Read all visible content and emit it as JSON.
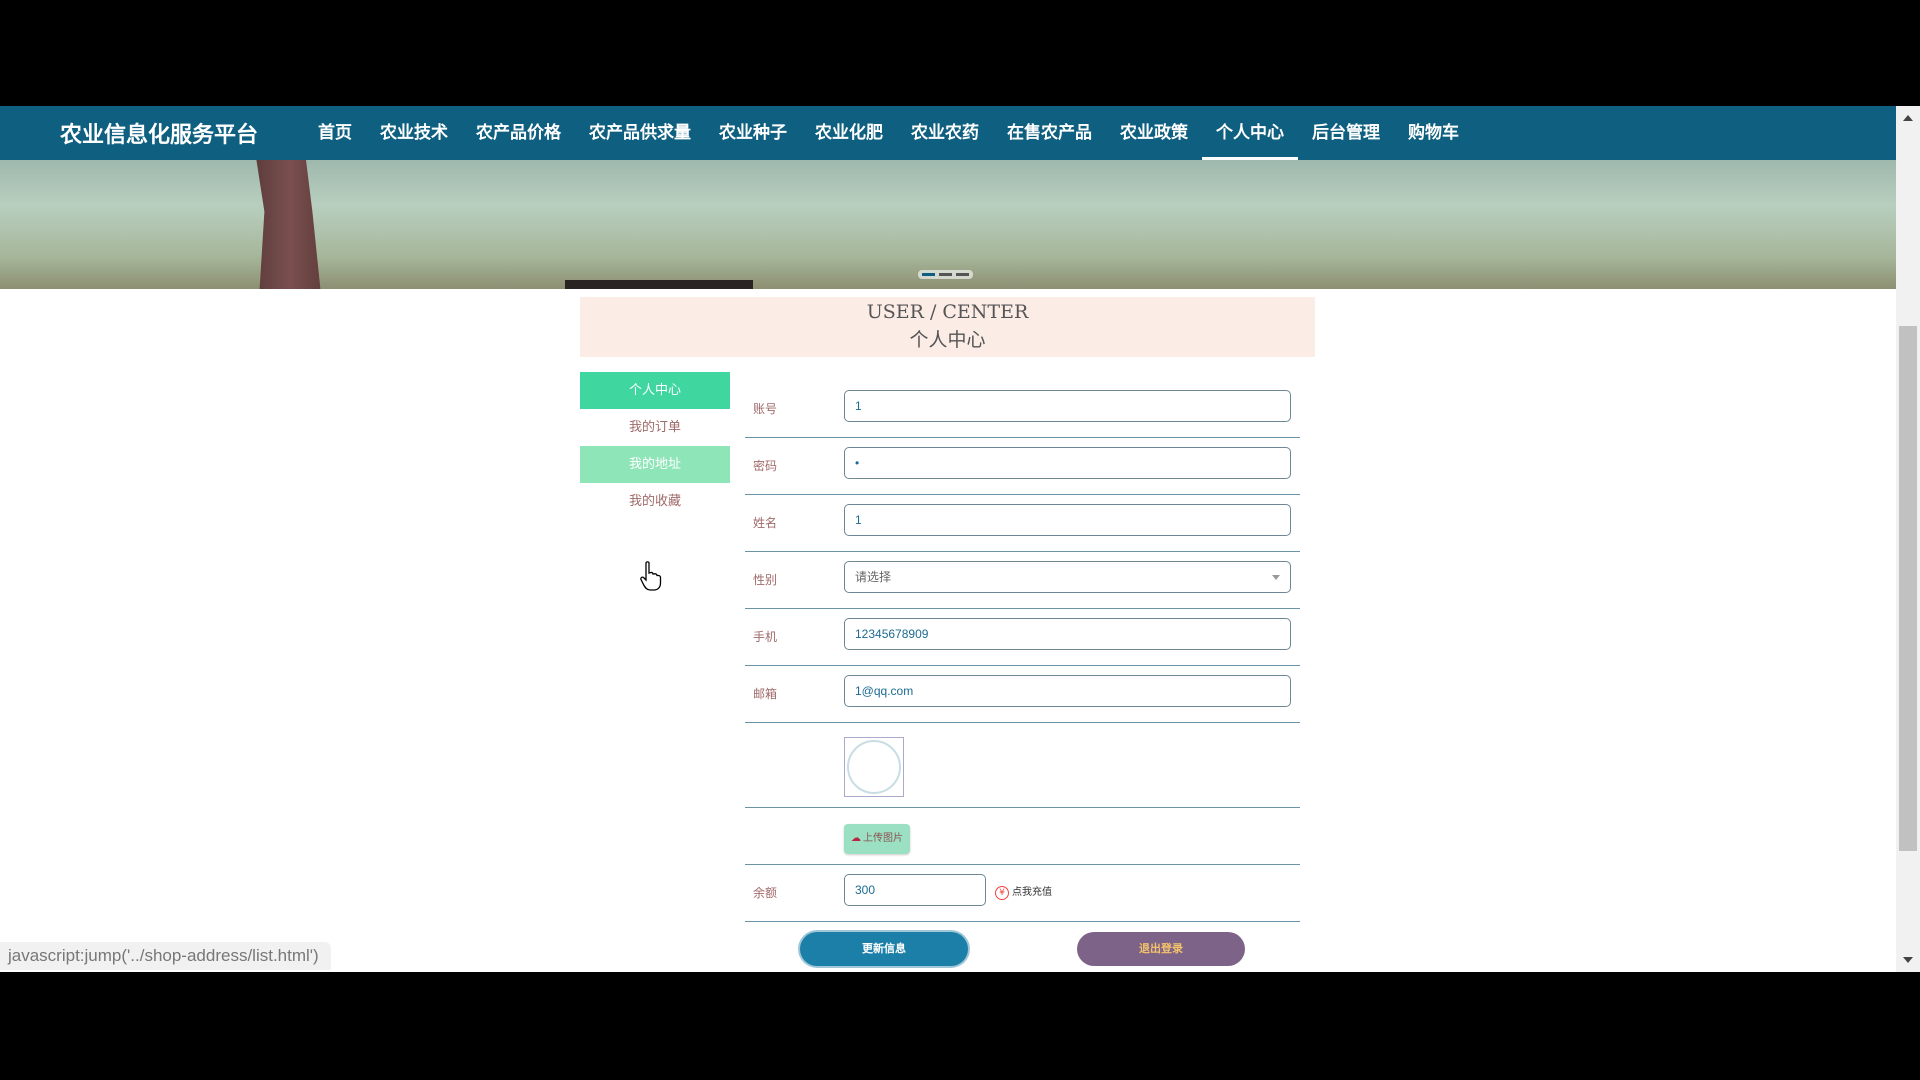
{
  "brand": "农业信息化服务平台",
  "nav": [
    "首页",
    "农业技术",
    "农产品价格",
    "农产品供求量",
    "农业种子",
    "农业化肥",
    "农业农药",
    "在售农产品",
    "农业政策",
    "个人中心",
    "后台管理",
    "购物车"
  ],
  "nav_active": "个人中心",
  "header": {
    "en": "USER / CENTER",
    "cn": "个人中心"
  },
  "side_menu": [
    "个人中心",
    "我的订单",
    "我的地址",
    "我的收藏"
  ],
  "form": {
    "account_label": "账号",
    "account_value": "1",
    "password_label": "密码",
    "password_value": "•",
    "name_label": "姓名",
    "name_value": "1",
    "gender_label": "性别",
    "gender_value": "请选择",
    "phone_label": "手机",
    "phone_value": "12345678909",
    "email_label": "邮箱",
    "email_value": "1@qq.com",
    "upload_label": "上传图片",
    "balance_label": "余额",
    "balance_value": "300",
    "recharge_label": "点我充值"
  },
  "buttons": {
    "update": "更新信息",
    "logout": "退出登录"
  },
  "status_url": "javascript:jump('../shop-address/list.html')",
  "colors": {
    "topbar": "#0e5f80",
    "side_active": "#3fd6a0",
    "update_btn": "#1c7fa8",
    "logout_btn": "#7d6388"
  }
}
